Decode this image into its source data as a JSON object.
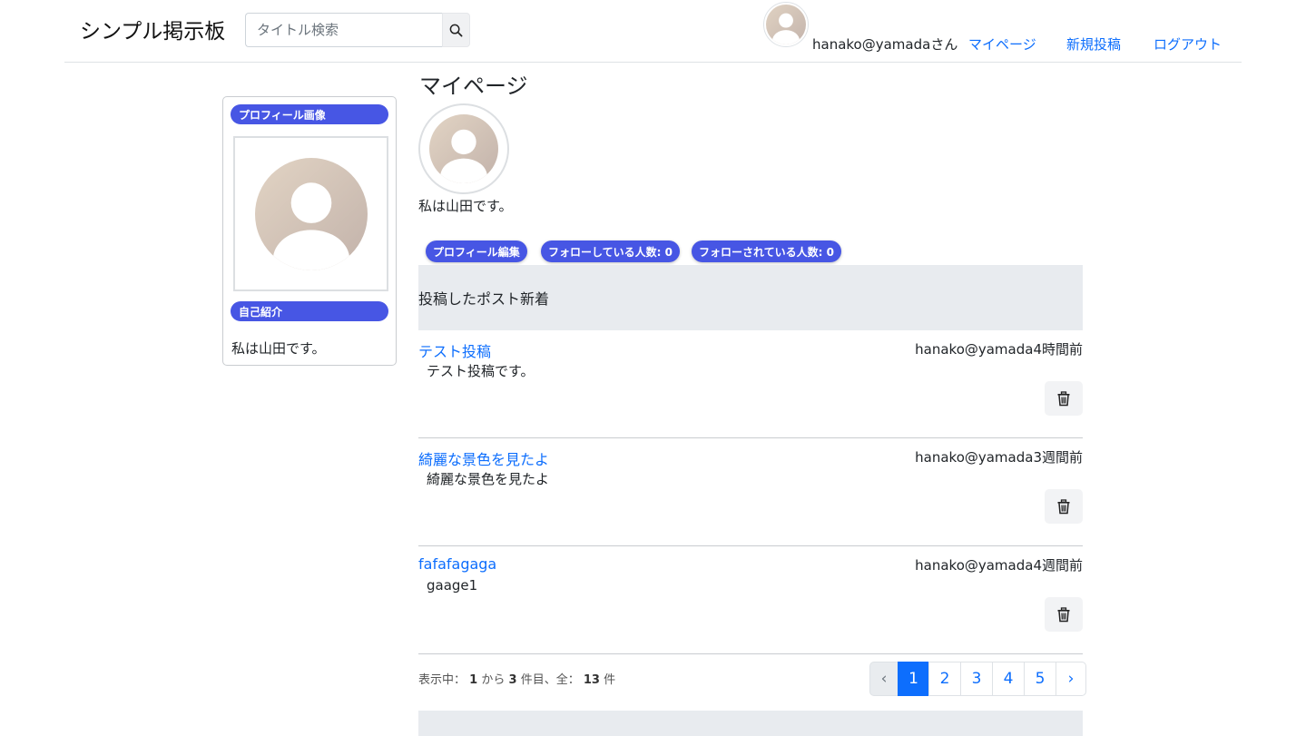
{
  "header": {
    "brand": "シンプル掲示板",
    "search_placeholder": "タイトル検索",
    "username": "hanako@yamadaさん",
    "nav": {
      "mypage": "マイページ",
      "new_post": "新規投稿",
      "logout": "ログアウト"
    }
  },
  "sidebar": {
    "profile_image_label": "プロフィール画像",
    "bio_label": "自己紹介",
    "bio": "私は山田です。"
  },
  "main": {
    "title": "マイページ",
    "bio": "私は山田です。",
    "buttons": {
      "edit_profile": "プロフィール編集",
      "following": "フォローしている人数: 0",
      "followers": "フォローされている人数: 0"
    },
    "section_title": "投稿したポスト新着",
    "posts": [
      {
        "title": "テスト投稿",
        "meta": "hanako@yamada4時間前",
        "body": "テスト投稿です。"
      },
      {
        "title": "綺麗な景色を見たよ",
        "meta": "hanako@yamada3週間前",
        "body": "綺麗な景色を見たよ"
      },
      {
        "title": "fafafagaga",
        "meta": "hanako@yamada4週間前",
        "body": "gaage1"
      }
    ]
  },
  "pagination": {
    "summary_prefix": "表示中：",
    "from": "1",
    "from_suffix": "から",
    "to": "3",
    "to_suffix": "件目、全：",
    "total": "13",
    "total_suffix": "件",
    "prev": "‹",
    "pages": [
      "1",
      "2",
      "3",
      "4",
      "5"
    ],
    "current": "1",
    "next": "›"
  },
  "colors": {
    "accent": "#4756e4",
    "link": "#0d6efd",
    "section_bg": "#e8ebef"
  },
  "icons": [
    "search-icon",
    "user-avatar-icon",
    "trash-icon"
  ]
}
